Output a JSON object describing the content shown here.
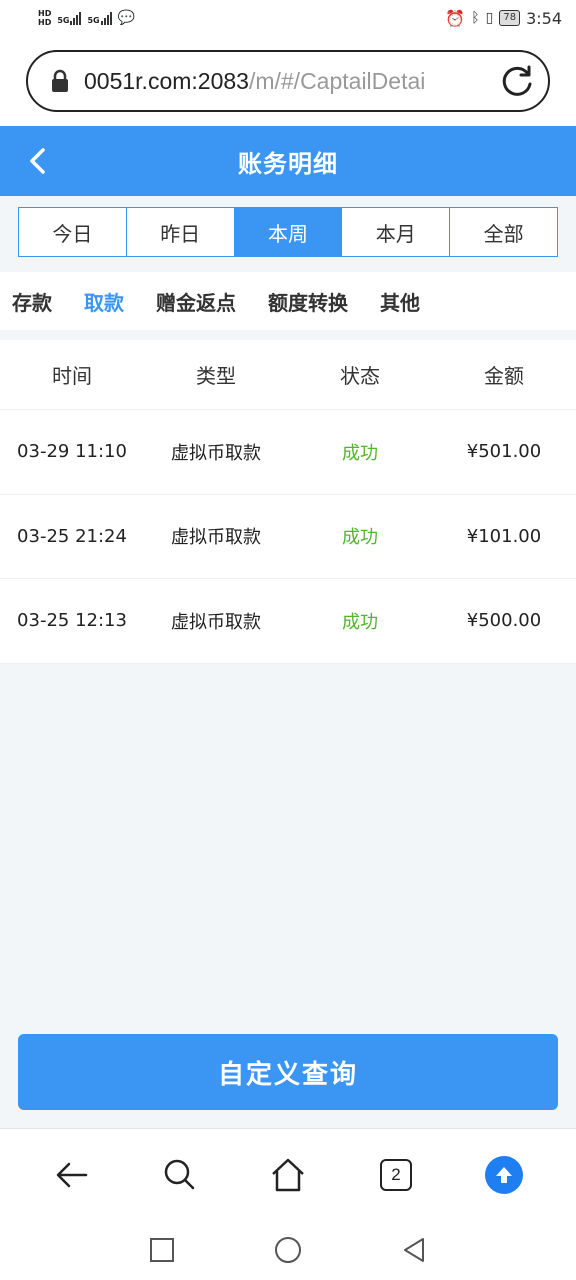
{
  "status_bar": {
    "sim_labels": [
      "HD",
      "HD"
    ],
    "net_labels": [
      "5G",
      "5G"
    ],
    "battery": "78",
    "time": "3:54",
    "icons": [
      "alarm-icon",
      "bluetooth-icon",
      "vibrate-icon",
      "battery-icon",
      "wechat-icon"
    ]
  },
  "browser": {
    "url_host": "0051r.com:2083",
    "url_path": "/m/#/CaptailDetai",
    "tab_count": "2"
  },
  "header": {
    "title": "账务明细"
  },
  "period_tabs": [
    {
      "label": "今日",
      "active": false
    },
    {
      "label": "昨日",
      "active": false
    },
    {
      "label": "本周",
      "active": true
    },
    {
      "label": "本月",
      "active": false
    },
    {
      "label": "全部",
      "active": false
    }
  ],
  "type_tabs": [
    {
      "label": "存款",
      "active": false
    },
    {
      "label": "取款",
      "active": true
    },
    {
      "label": "赠金返点",
      "active": false
    },
    {
      "label": "额度转换",
      "active": false
    },
    {
      "label": "其他",
      "active": false
    }
  ],
  "table": {
    "headers": [
      "时间",
      "类型",
      "状态",
      "金额"
    ],
    "rows": [
      {
        "time": "03-29 11:10",
        "type": "虚拟币取款",
        "status": "成功",
        "amount": "¥501.00"
      },
      {
        "time": "03-25 21:24",
        "type": "虚拟币取款",
        "status": "成功",
        "amount": "¥101.00"
      },
      {
        "time": "03-25 12:13",
        "type": "虚拟币取款",
        "status": "成功",
        "amount": "¥500.00"
      }
    ]
  },
  "query_button": "自定义查询",
  "colors": {
    "accent": "#3b96f3",
    "success": "#52b52c"
  }
}
